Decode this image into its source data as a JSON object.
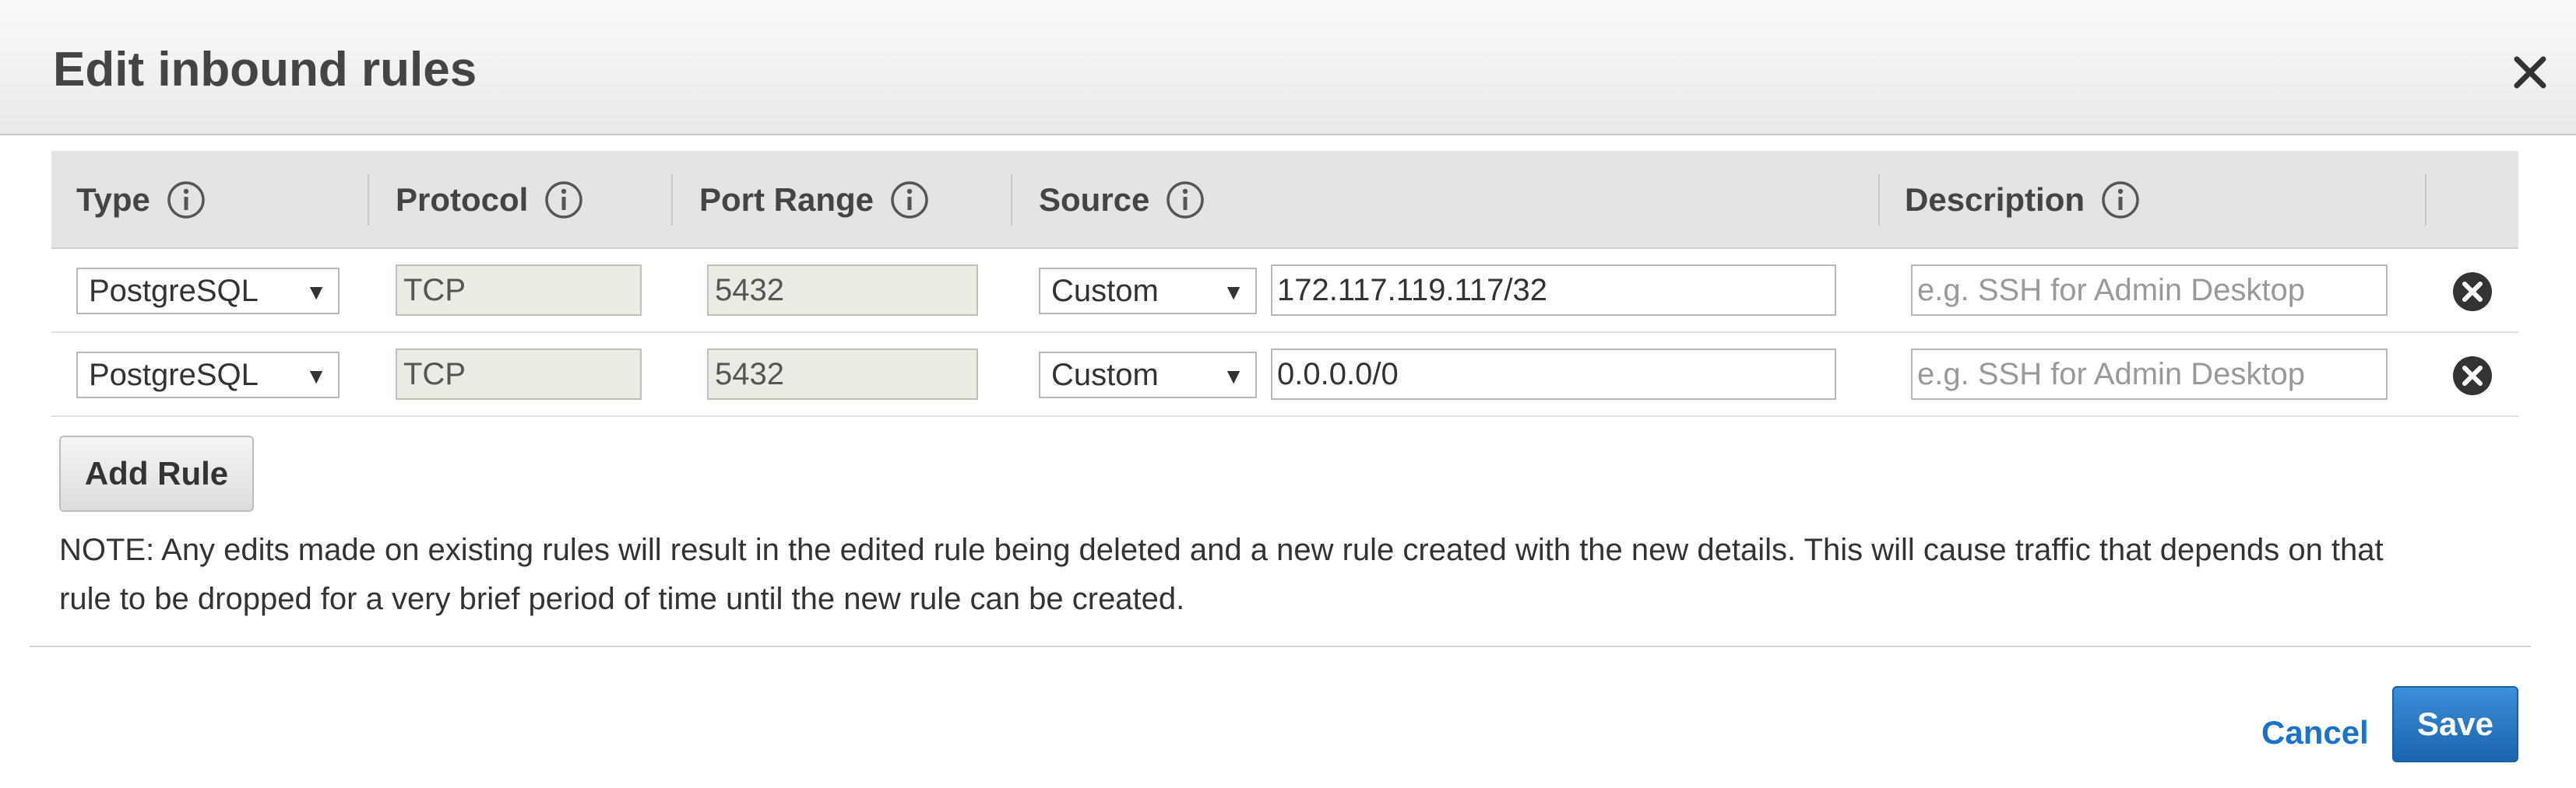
{
  "dialog": {
    "title": "Edit inbound rules"
  },
  "table": {
    "headers": {
      "type": "Type",
      "protocol": "Protocol",
      "port_range": "Port Range",
      "source": "Source",
      "description": "Description"
    },
    "rows": [
      {
        "type": "PostgreSQL",
        "protocol": "TCP",
        "port_range": "5432",
        "source_type": "Custom",
        "source_value": "172.117.119.117/32",
        "description_value": "",
        "description_placeholder": "e.g. SSH for Admin Desktop"
      },
      {
        "type": "PostgreSQL",
        "protocol": "TCP",
        "port_range": "5432",
        "source_type": "Custom",
        "source_value": "0.0.0.0/0",
        "description_value": "",
        "description_placeholder": "e.g. SSH for Admin Desktop"
      }
    ]
  },
  "actions": {
    "add_rule": "Add Rule",
    "cancel": "Cancel",
    "save": "Save"
  },
  "note": "NOTE: Any edits made on existing rules will result in the edited rule being deleted and a new rule created with the new details. This will cause traffic that depends on that rule to be dropped for a very brief period of time until the new rule can be created.",
  "icons": {
    "close": "close-icon",
    "info": "info-icon",
    "remove": "remove-circle-icon",
    "dropdown": "dropdown-arrow-icon"
  },
  "colors": {
    "primary_button": "#1d63ae",
    "link": "#1a73c9",
    "header_bg": "#e4e4e4"
  }
}
